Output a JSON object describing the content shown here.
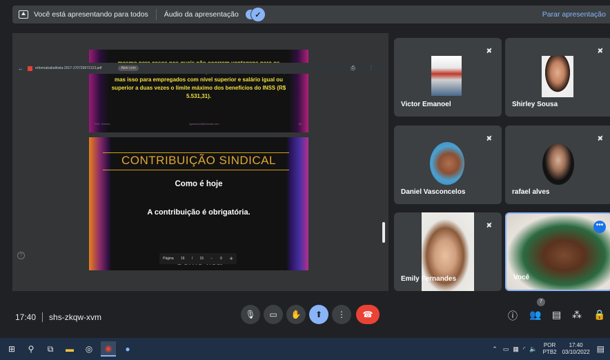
{
  "topbar": {
    "presenting_text": "Você está apresentando para todos",
    "audio_label": "Áudio da apresentação",
    "toggle_check": "✓",
    "stop_presenting": "Parar apresentação"
  },
  "pdf": {
    "filename": "reformatrabalhista-2017-170729972123.pdf",
    "zoom_pill": "Abrir com",
    "icons": "⎙ ⋮"
  },
  "slide1": {
    "text": "mesmo para casos nos quais não ocorram vantagens para os trabalhadores. Acordos individuais prevalecerão sobre o coletivo, mas isso para empregados com nível superior e salário igual ou superior a duas vezes o limite máximo dos benefícios do INSS (R$ 5.531,31).",
    "footer_left": "Prof. Gomes",
    "footer_mid": "fgomes43@hotmail.com",
    "footer_right": "35"
  },
  "slide2": {
    "title": "CONTRIBUIÇÃO SINDICAL",
    "subtitle": "Como é hoje",
    "body": "A contribuição é obrigatória.",
    "ghost": "Como fica"
  },
  "pager": {
    "label": "Página",
    "page": "16",
    "sep": "/",
    "total": "15",
    "zoom_out": "−",
    "search": "⚲",
    "zoom_in": "+"
  },
  "participants": [
    {
      "name": "Victor Emanoel",
      "mic": "✖̸"
    },
    {
      "name": "Shirley Sousa",
      "mic": "✖̸"
    },
    {
      "name": "Daniel Vasconcelos",
      "mic": "✖̸"
    },
    {
      "name": "rafael alves",
      "mic": "✖̸"
    },
    {
      "name": "Emily Fernandes",
      "mic": "✖̸"
    },
    {
      "name": "Você",
      "more": "•••"
    }
  ],
  "controls": {
    "time": "17:40",
    "meeting_code": "shs-zkqw-xvm",
    "people_count": "7"
  },
  "taskbar": {
    "lang_top": "POR",
    "lang_bottom": "PTB2",
    "clock_time": "17:40",
    "clock_date": "03/10/2022"
  },
  "colors": {
    "accent": "#8ab4f8",
    "end_call": "#ea4335",
    "surface": "#3c4043",
    "background": "#202124",
    "slide_yellow": "#f0e040",
    "slide_title": "#e0a830"
  }
}
